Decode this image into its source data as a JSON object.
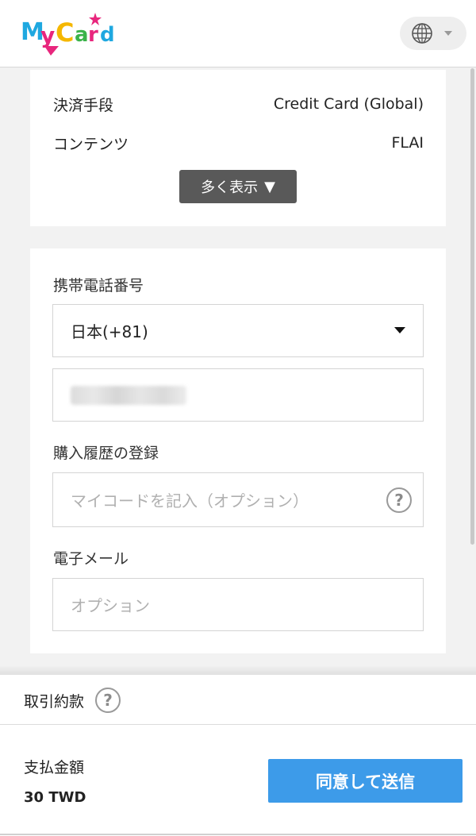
{
  "header": {
    "logo_text": "MyCard",
    "language_icon": "globe-icon",
    "language_caret_icon": "caret-down-icon"
  },
  "summary": {
    "payment_method_label": "決済手段",
    "payment_method_value": "Credit Card (Global)",
    "content_label": "コンテンツ",
    "content_value": "FLAI",
    "show_more_label": "多く表示",
    "show_more_icon": "▼"
  },
  "form": {
    "phone_label": "携帯電話番号",
    "country_select_value": "日本(+81)",
    "mycode_label": "購入履歴の登録",
    "mycode_placeholder": "マイコードを記入（オプション）",
    "email_label": "電子メール",
    "email_placeholder": "オプション"
  },
  "footer": {
    "terms_label": "取引約款",
    "amount_label": "支払金額",
    "amount_value": "30 TWD",
    "submit_label": "同意して送信"
  },
  "colors": {
    "accent": "#3d9be9",
    "dark_button": "#595959",
    "background": "#f2f2f2"
  }
}
